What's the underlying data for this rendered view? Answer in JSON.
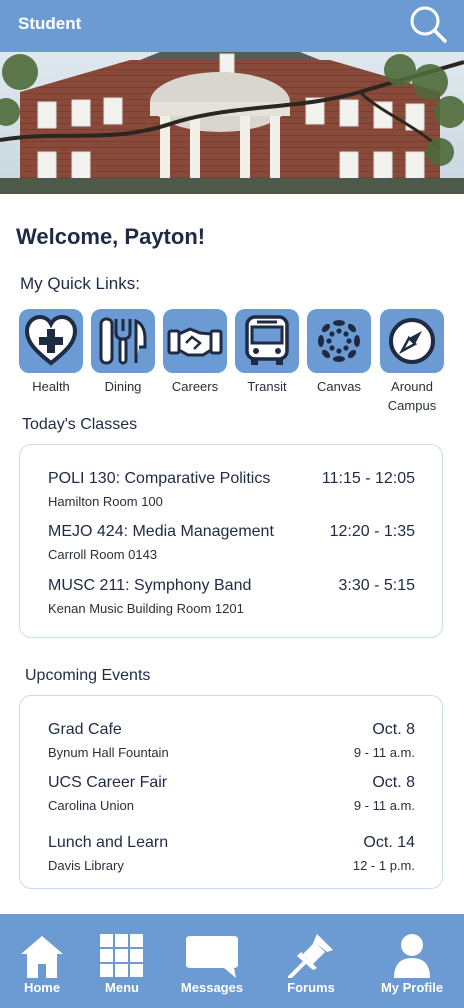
{
  "header": {
    "title": "Student",
    "search_icon": "search-icon"
  },
  "welcome": "Welcome, Payton!",
  "quick_links": {
    "title": "My Quick Links:",
    "items": [
      {
        "label": "Health",
        "icon": "heart-plus-icon"
      },
      {
        "label": "Dining",
        "icon": "fork-knife-icon"
      },
      {
        "label": "Careers",
        "icon": "handshake-icon"
      },
      {
        "label": "Transit",
        "icon": "bus-icon"
      },
      {
        "label": "Canvas",
        "icon": "canvas-logo-icon"
      },
      {
        "label": "Around Campus",
        "icon": "compass-icon"
      }
    ]
  },
  "classes": {
    "title": "Today's Classes",
    "items": [
      {
        "name": "POLI 130: Comparative Politics",
        "location": "Hamilton Room 100",
        "time": "11:15 - 12:05"
      },
      {
        "name": "MEJO 424: Media Management",
        "location": "Carroll Room 0143",
        "time": "12:20 - 1:35"
      },
      {
        "name": "MUSC 211: Symphony Band",
        "location": "Kenan Music Building Room 1201",
        "time": "3:30 - 5:15"
      }
    ]
  },
  "events": {
    "title": "Upcoming Events",
    "items": [
      {
        "name": "Grad Cafe",
        "location": "Bynum Hall Fountain",
        "date": "Oct. 8",
        "time": "9 - 11 a.m."
      },
      {
        "name": "UCS Career Fair",
        "location": "Carolina Union",
        "date": "Oct. 8",
        "time": "9 - 11 a.m."
      },
      {
        "name": "Lunch and Learn",
        "location": "Davis Library",
        "date": "Oct. 14",
        "time": "12 - 1 p.m."
      }
    ]
  },
  "nav": {
    "items": [
      {
        "label": "Home",
        "icon": "home-icon"
      },
      {
        "label": "Menu",
        "icon": "grid-icon"
      },
      {
        "label": "Messages",
        "icon": "chat-bubble-icon"
      },
      {
        "label": "Forums",
        "icon": "pin-icon"
      },
      {
        "label": "My Profile",
        "icon": "user-icon"
      }
    ]
  },
  "colors": {
    "primary": "#6b9bd2",
    "icon_dark": "#1f2a44",
    "text": "#1f2a44",
    "card_border": "#c8dcef"
  }
}
